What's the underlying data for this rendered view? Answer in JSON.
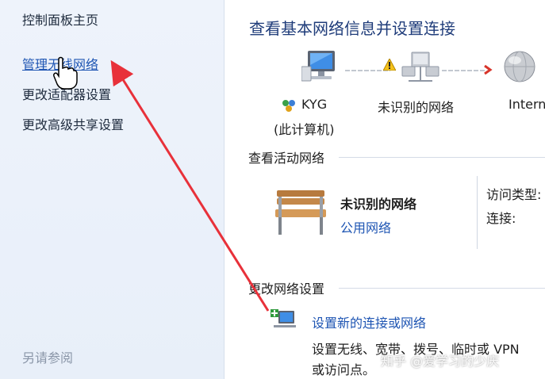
{
  "sidebar": {
    "items": [
      {
        "label": "控制面板主页"
      },
      {
        "label": "管理无线网络"
      },
      {
        "label": "更改适配器设置"
      },
      {
        "label": "更改高级共享设置"
      }
    ],
    "see_also": "另请参阅"
  },
  "main": {
    "title": "查看基本网络信息并设置连接",
    "map": {
      "computer_name": "KYG",
      "computer_sub": "(此计算机)",
      "network_label": "未识别的网络",
      "internet_label": "Internet"
    },
    "active": {
      "section_title": "查看活动网络",
      "network_name": "未识别的网络",
      "network_type": "公用网络",
      "access_type_label": "访问类型:",
      "connection_label": "连接:"
    },
    "change": {
      "section_title": "更改网络设置",
      "task_link": "设置新的连接或网络",
      "task_desc_line1": "设置无线、宽带、拨号、临时或 VPN",
      "task_desc_line2": "或访问点。"
    }
  },
  "watermark": "知乎 @爱学习的少庆",
  "colors": {
    "link": "#1e55b3",
    "arrow": "#e8313a",
    "sidebar_bg": "#eef3fb",
    "title": "#1f3c7a"
  }
}
